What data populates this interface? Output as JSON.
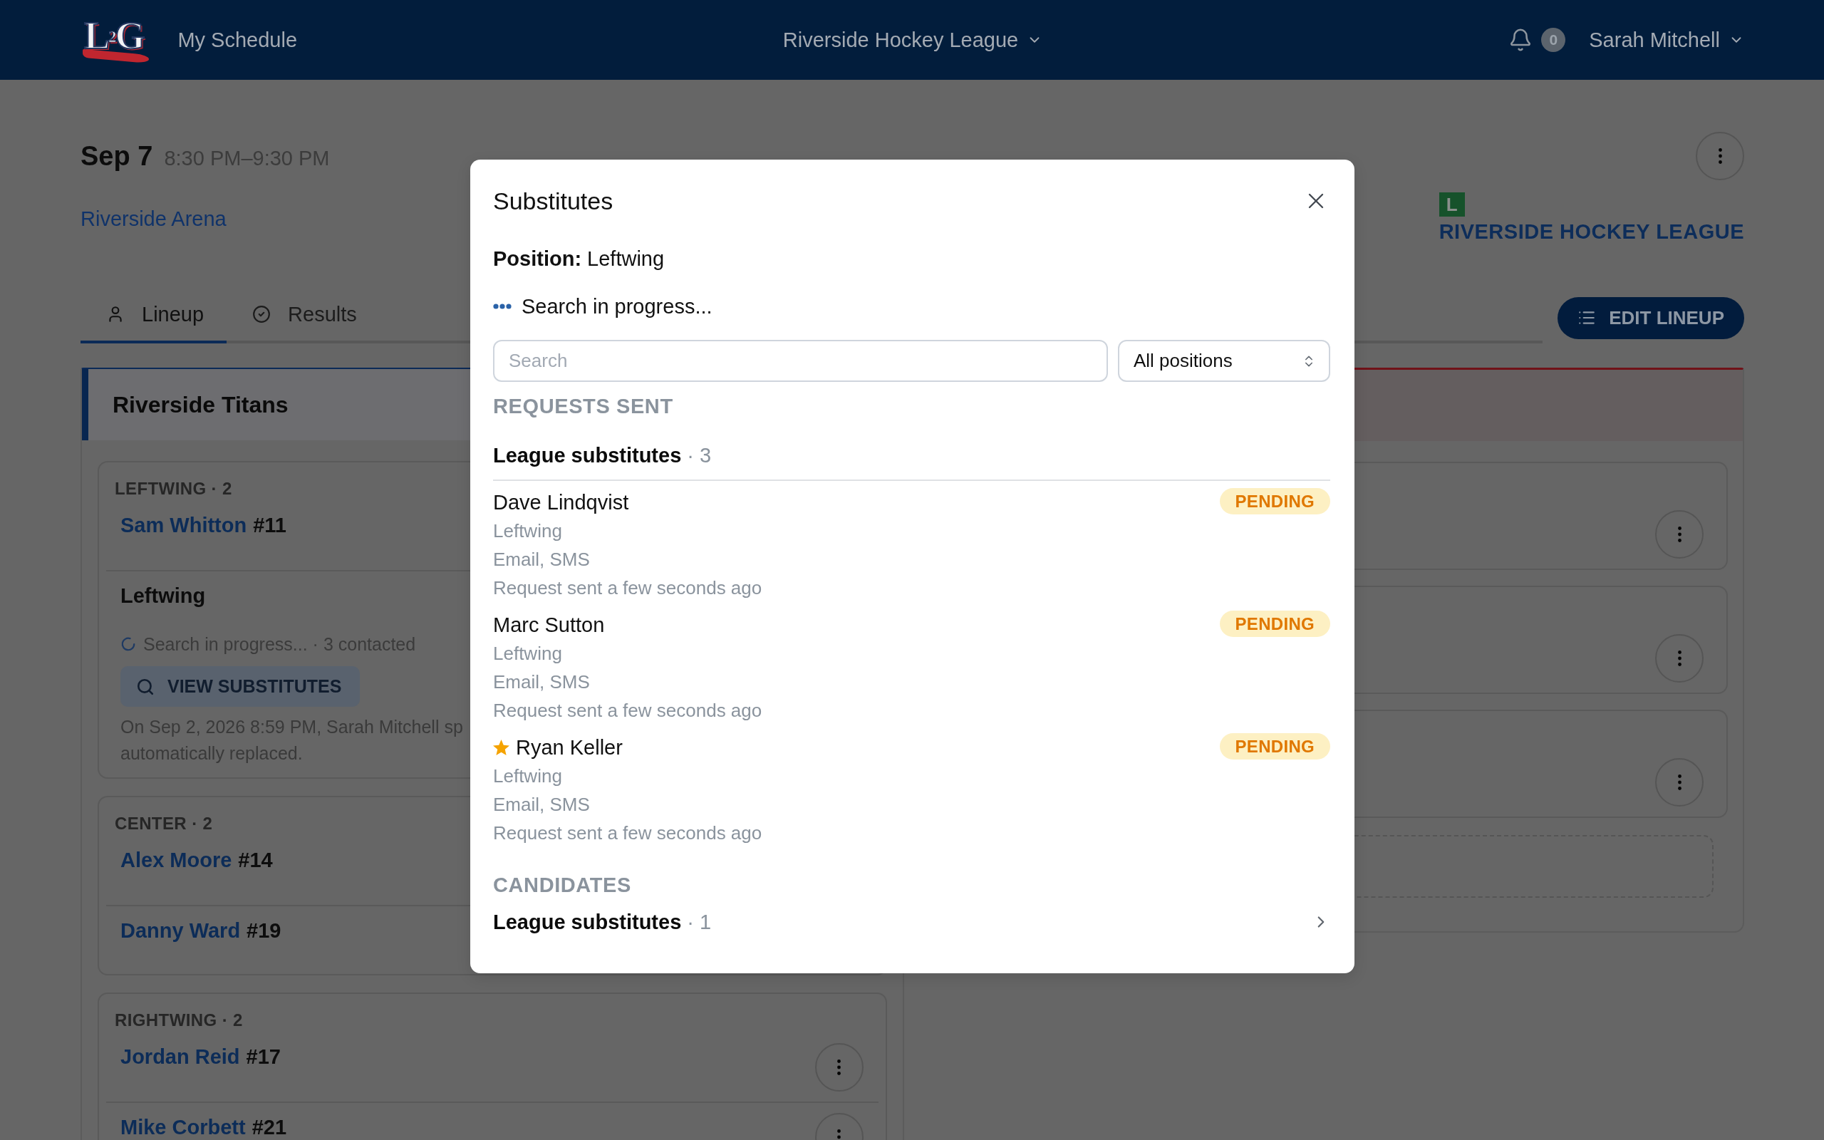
{
  "top_bar": {
    "logo": "L$^{2}$G",
    "nav_link": "My Schedule",
    "league_selector": "Riverside Hockey League",
    "notification_count": "0",
    "user_name": "Sarah Mitchell"
  },
  "event": {
    "date": "Sep 7",
    "time": "8:30 PM–9:30 PM",
    "venue": "Riverside Arena",
    "league_badge": "L",
    "league_name": "RIVERSIDE HOCKEY LEAGUE"
  },
  "tabs": [
    {
      "label": "Lineup",
      "selected": true
    },
    {
      "label": "Results",
      "selected": false
    }
  ],
  "edit_button": "EDIT LINEUP",
  "left_team": {
    "name": "Riverside Titans",
    "positions": [
      {
        "title": "LEFTWING · 2",
        "rows": [
          {
            "kind": "player",
            "name": "Sam Whitton",
            "number": "#11",
            "more_button": false
          },
          {
            "kind": "open_slot",
            "title": "Leftwing",
            "status": "Search in progress... · 3 contacted",
            "action": "VIEW SUBSTITUTES",
            "note": [
              "On Sep 2, 2026 8:59 PM, Sarah Mitchell sp",
              "automatically replaced."
            ]
          }
        ]
      },
      {
        "title": "CENTER · 2",
        "rows": [
          {
            "kind": "player",
            "name": "Alex Moore",
            "number": "#14",
            "more_button": false
          },
          {
            "kind": "player",
            "name": "Danny Ward",
            "number": "#19",
            "more_button": false
          }
        ]
      },
      {
        "title": "RIGHTWING · 2",
        "rows": [
          {
            "kind": "player",
            "name": "Jordan Reid",
            "number": "#17",
            "more_button": true
          },
          {
            "kind": "player",
            "name": "Mike Corbett",
            "number": "#21",
            "more_button": true
          }
        ]
      }
    ]
  },
  "right_team": {
    "rows": [
      {
        "more_button": true
      },
      {
        "more_button": true
      },
      {
        "more_button": true
      }
    ],
    "empty_slot": true
  },
  "modal": {
    "title": "Substitutes",
    "position": "**Position:** Leftwing",
    "search_status": "Search in progress...",
    "search": {
      "placeholder": "Search"
    },
    "position_filter": {
      "value": "All positions"
    },
    "sections": [
      {
        "heading": "REQUESTS SENT",
        "groups": [
          {
            "title": "League substitutes",
            "count": "· 3",
            "items": [
              {
                "name": "Dave Lindqvist",
                "starred": false,
                "position": "Leftwing",
                "channels": "Email, SMS",
                "sent": "Request sent a few seconds ago",
                "status": "PENDING"
              },
              {
                "name": "Marc Sutton",
                "starred": false,
                "position": "Leftwing",
                "channels": "Email, SMS",
                "sent": "Request sent a few seconds ago",
                "status": "PENDING"
              },
              {
                "name": "Ryan Keller",
                "starred": true,
                "position": "Leftwing",
                "channels": "Email, SMS",
                "sent": "Request sent a few seconds ago",
                "status": "PENDING"
              }
            ]
          }
        ]
      },
      {
        "heading": "CANDIDATES",
        "groups": [
          {
            "title": "League substitutes",
            "count": "· 1",
            "expanded": false
          }
        ]
      }
    ]
  }
}
